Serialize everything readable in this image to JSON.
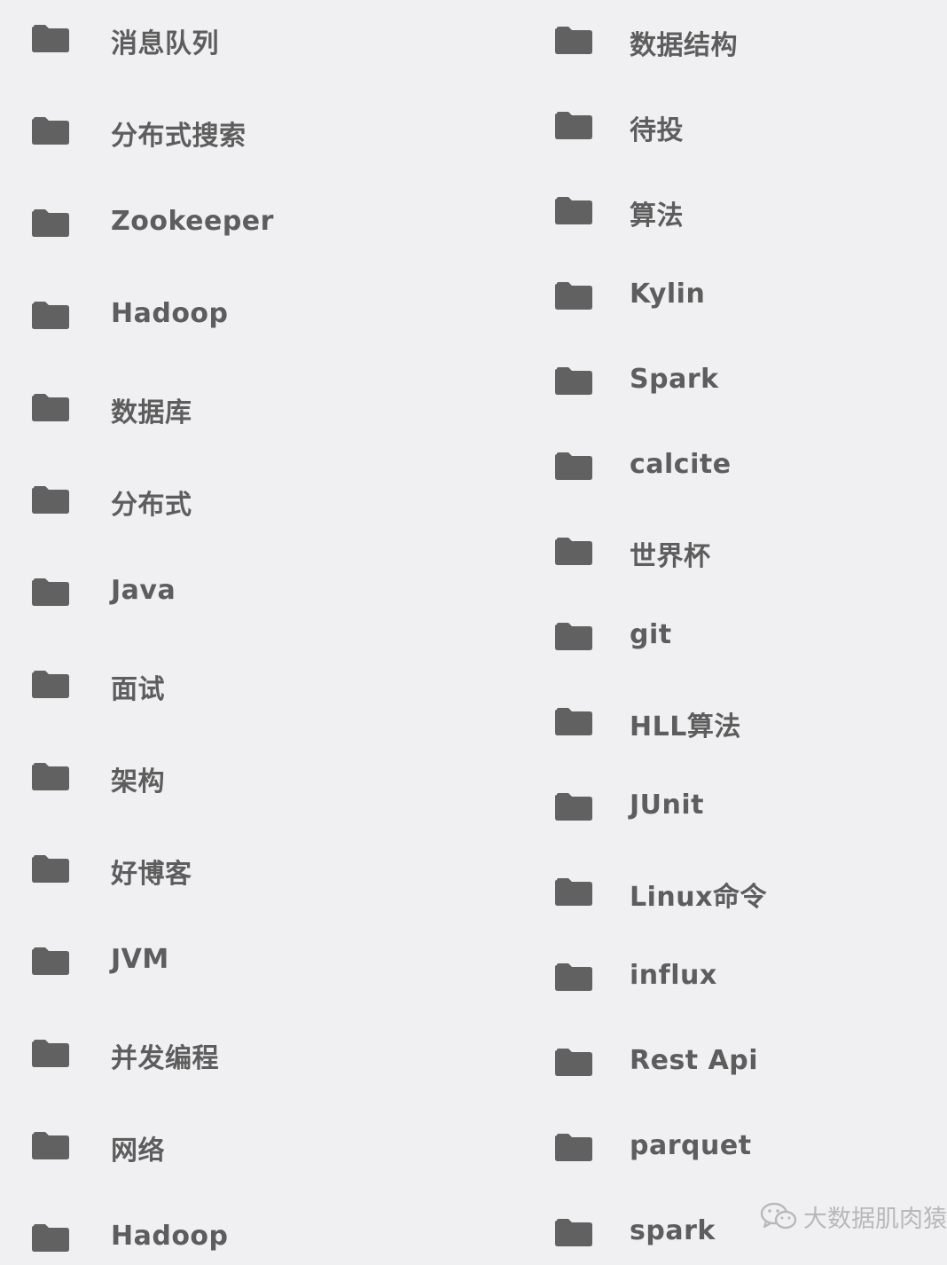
{
  "folders_left": [
    {
      "label": "消息队列",
      "icon": "folder-icon"
    },
    {
      "label": "分布式搜索",
      "icon": "folder-icon"
    },
    {
      "label": "Zookeeper",
      "icon": "folder-icon"
    },
    {
      "label": "Hadoop",
      "icon": "folder-icon"
    },
    {
      "label": "数据库",
      "icon": "folder-icon"
    },
    {
      "label": "分布式",
      "icon": "folder-icon"
    },
    {
      "label": "Java",
      "icon": "folder-icon"
    },
    {
      "label": "面试",
      "icon": "folder-icon"
    },
    {
      "label": "架构",
      "icon": "folder-icon"
    },
    {
      "label": "好博客",
      "icon": "folder-icon"
    },
    {
      "label": "JVM",
      "icon": "folder-icon"
    },
    {
      "label": "并发编程",
      "icon": "folder-icon"
    },
    {
      "label": "网络",
      "icon": "folder-icon"
    },
    {
      "label": "Hadoop",
      "icon": "folder-icon"
    }
  ],
  "folders_right": [
    {
      "label": "数据结构",
      "icon": "folder-icon"
    },
    {
      "label": "待投",
      "icon": "folder-icon"
    },
    {
      "label": "算法",
      "icon": "folder-icon"
    },
    {
      "label": "Kylin",
      "icon": "folder-icon"
    },
    {
      "label": "Spark",
      "icon": "folder-icon"
    },
    {
      "label": "calcite",
      "icon": "folder-icon"
    },
    {
      "label": "世界杯",
      "icon": "folder-icon"
    },
    {
      "label": "git",
      "icon": "folder-icon"
    },
    {
      "label": "HLL算法",
      "icon": "folder-icon"
    },
    {
      "label": "JUnit",
      "icon": "folder-icon"
    },
    {
      "label": "Linux命令",
      "icon": "folder-icon"
    },
    {
      "label": "influx",
      "icon": "folder-icon"
    },
    {
      "label": "Rest Api",
      "icon": "folder-icon"
    },
    {
      "label": "parquet",
      "icon": "folder-icon"
    },
    {
      "label": "spark",
      "icon": "folder-icon"
    }
  ],
  "watermark": {
    "text": "大数据肌肉猿",
    "icon": "wechat-icon"
  },
  "colors": {
    "background": "#f0f0f2",
    "folder": "#616161",
    "text": "#5d5d5d",
    "watermark": "#b8b8b8"
  }
}
